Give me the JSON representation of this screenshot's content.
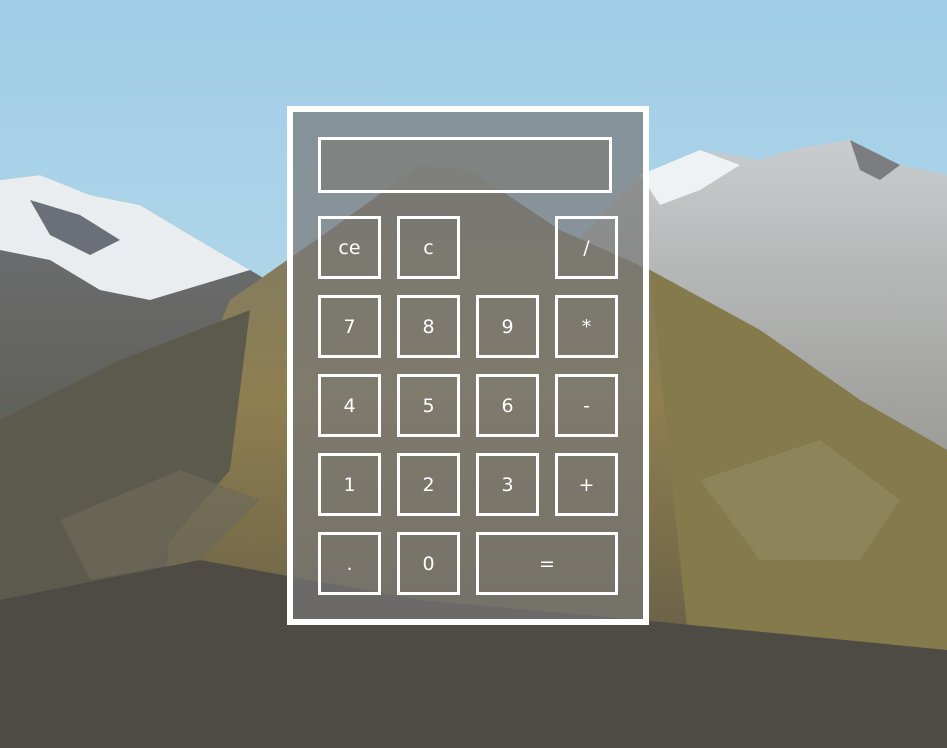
{
  "calculator": {
    "display_value": "",
    "keys": {
      "ce": "ce",
      "c": "c",
      "divide": "/",
      "seven": "7",
      "eight": "8",
      "nine": "9",
      "multiply": "*",
      "four": "4",
      "five": "5",
      "six": "6",
      "subtract": "-",
      "one": "1",
      "two": "2",
      "three": "3",
      "add": "+",
      "decimal": ".",
      "zero": "0",
      "equals": "="
    }
  },
  "colors": {
    "sky": "#a9d3e7",
    "frame": "#ffffff",
    "panel": "#787878",
    "text": "#ffffff"
  }
}
